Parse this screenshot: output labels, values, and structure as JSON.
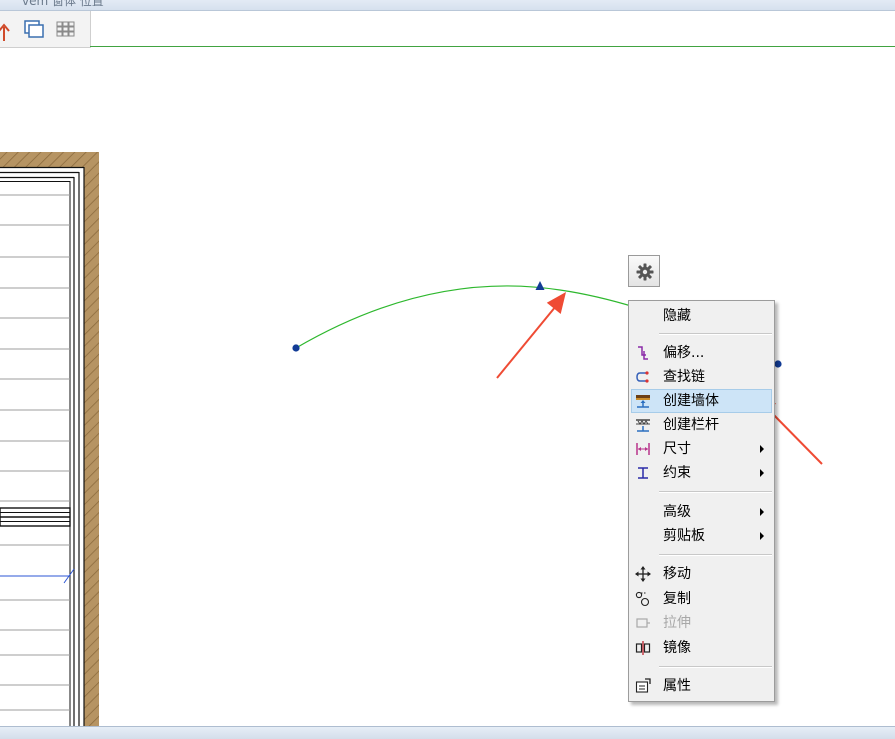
{
  "title_strip": {
    "text_fragment": "vem  窗体 位置"
  },
  "toolbar": {
    "icons": [
      "up-arrow-icon",
      "window-tile-icon",
      "grid-icon"
    ]
  },
  "drawing": {
    "arc_color": "#2eb82e",
    "endpoint_color": "#123c96",
    "arrow_color": "#ef4b34",
    "wall_hatch_color": "#b69463"
  },
  "gear_button": {
    "icon": "gear-icon"
  },
  "context_menu": {
    "items": [
      {
        "label": "隐藏",
        "icon": "",
        "submenu": false,
        "enabled": true,
        "highlighted": false
      },
      {
        "label": "偏移...",
        "icon": "offset-icon",
        "submenu": false,
        "enabled": true,
        "highlighted": false
      },
      {
        "label": "查找链",
        "icon": "find-chain-icon",
        "submenu": false,
        "enabled": true,
        "highlighted": false
      },
      {
        "label": "创建墙体",
        "icon": "create-wall-icon",
        "submenu": false,
        "enabled": true,
        "highlighted": true
      },
      {
        "label": "创建栏杆",
        "icon": "create-railing-icon",
        "submenu": false,
        "enabled": true,
        "highlighted": false
      },
      {
        "label": "尺寸",
        "icon": "dimension-icon",
        "submenu": true,
        "enabled": true,
        "highlighted": false
      },
      {
        "label": "约束",
        "icon": "constraint-icon",
        "submenu": true,
        "enabled": true,
        "highlighted": false
      },
      {
        "label": "高级",
        "icon": "",
        "submenu": true,
        "enabled": true,
        "highlighted": false
      },
      {
        "label": "剪贴板",
        "icon": "",
        "submenu": true,
        "enabled": true,
        "highlighted": false
      },
      {
        "label": "移动",
        "icon": "move-icon",
        "submenu": false,
        "enabled": true,
        "highlighted": false
      },
      {
        "label": "复制",
        "icon": "copy-icon",
        "submenu": false,
        "enabled": true,
        "highlighted": false
      },
      {
        "label": "拉伸",
        "icon": "stretch-icon",
        "submenu": false,
        "enabled": false,
        "highlighted": false
      },
      {
        "label": "镜像",
        "icon": "mirror-icon",
        "submenu": false,
        "enabled": true,
        "highlighted": false
      },
      {
        "label": "属性",
        "icon": "properties-icon",
        "submenu": false,
        "enabled": true,
        "highlighted": false
      }
    ]
  }
}
